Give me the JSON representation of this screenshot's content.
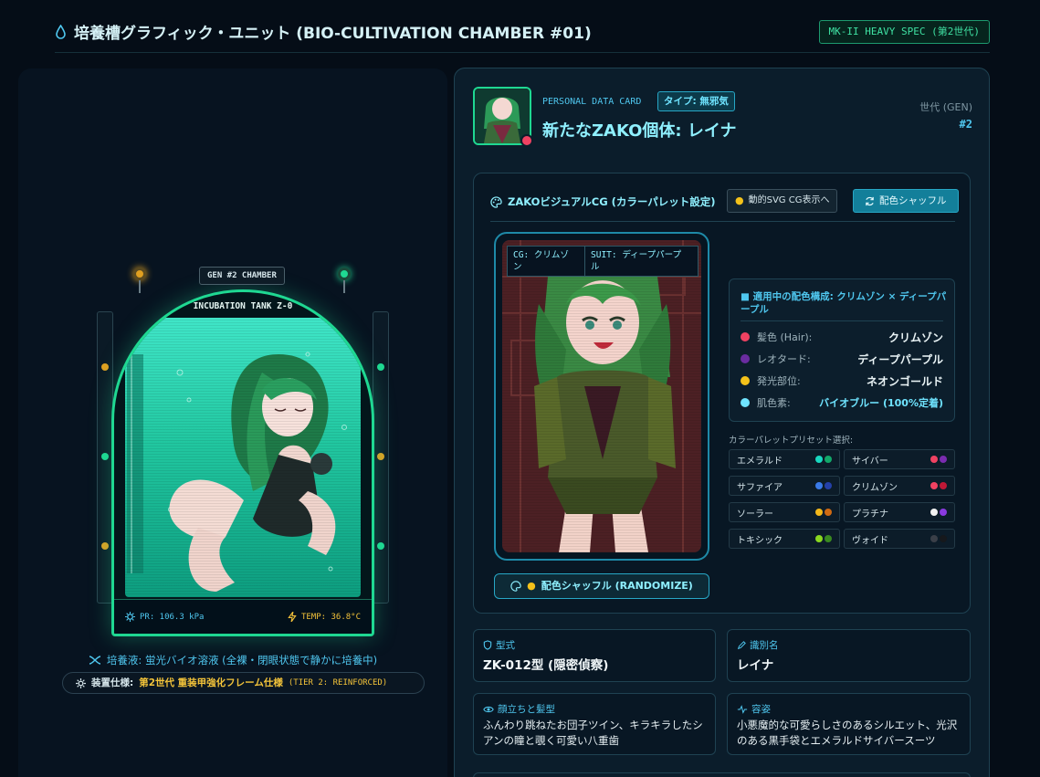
{
  "header": {
    "title": "培養槽グラフィック・ユニット (BIO-CULTIVATION CHAMBER #01)",
    "badge": "MK-II HEAVY SPEC (第2世代)"
  },
  "chamber": {
    "gen_label": "GEN #2 CHAMBER",
    "tank_name": "INCUBATION TANK Z-0",
    "pressure": "PR: 106.3 kPa",
    "temperature": "TEMP: 36.8°C",
    "caption": "培養液: 蛍光バイオ溶液 (全裸・閉眼状態で静かに培養中)",
    "spec_key": "装置仕様:",
    "spec_value": "第2世代 重装甲強化フレーム仕様",
    "spec_tier": "(TIER 2: REINFORCED)"
  },
  "card": {
    "section_label": "PERSONAL DATA CARD",
    "type_badge": "タイプ: 無邪気",
    "name": "新たなZAKO個体: レイナ",
    "gen_label": "世代 (GEN)",
    "gen_value": "#2"
  },
  "visual": {
    "title": "ZAKOビジュアルCG (カラーパレット設定)",
    "svg_button": "動的SVG CG表示へ",
    "shuffle_button": "配色シャッフル",
    "cg_tag_color": "CG: クリムゾ\nン",
    "cg_tag_suit": "SUIT: ディープパープ\nル",
    "randomize_button": "配色シャッフル (RANDOMIZE)",
    "palette_title": "■ 適用中の配色構成: クリムゾン × ディープパープル",
    "palette": [
      {
        "key": "髪色 (Hair):",
        "value": "クリムゾン",
        "color": "#f04262"
      },
      {
        "key": "レオタード:",
        "value": "ディープパープル",
        "color": "#6a2ca0"
      },
      {
        "key": "発光部位:",
        "value": "ネオンゴールド",
        "color": "#f4c21a"
      },
      {
        "key": "肌色素:",
        "value": "バイオブルー (100%定着)",
        "color": "#6fe4ff"
      }
    ],
    "preset_label": "カラーパレットプリセット選択:",
    "presets": [
      {
        "name": "エメラルド",
        "c1": "#19d8c0",
        "c2": "#12a86a"
      },
      {
        "name": "サイバー",
        "c1": "#f04262",
        "c2": "#7a2cb0"
      },
      {
        "name": "サファイア",
        "c1": "#3a7ae8",
        "c2": "#2440a8"
      },
      {
        "name": "クリムゾン",
        "c1": "#f04262",
        "c2": "#c01836"
      },
      {
        "name": "ソーラー",
        "c1": "#f4b81a",
        "c2": "#d06a12"
      },
      {
        "name": "プラチナ",
        "c1": "#f2f2f2",
        "c2": "#8a3ae0"
      },
      {
        "name": "トキシック",
        "c1": "#8ad820",
        "c2": "#3a8a20"
      },
      {
        "name": "ヴォイド",
        "c1": "#3a3f48",
        "c2": "#16181c"
      }
    ]
  },
  "details": {
    "model_label": "型式",
    "model_value": "ZK-012型 (隠密偵察)",
    "id_label": "識別名",
    "id_value": "レイナ",
    "face_label": "顔立ちと髪型",
    "face_text": "ふんわり跳ねたお団子ツイン、キラキラしたシアンの瞳と覗く可愛い八重歯",
    "look_label": "容姿",
    "look_text": "小悪魔的な可愛らしさのあるシルエット、光沢のある黒手袋とエメラルドサイバースーツ"
  }
}
